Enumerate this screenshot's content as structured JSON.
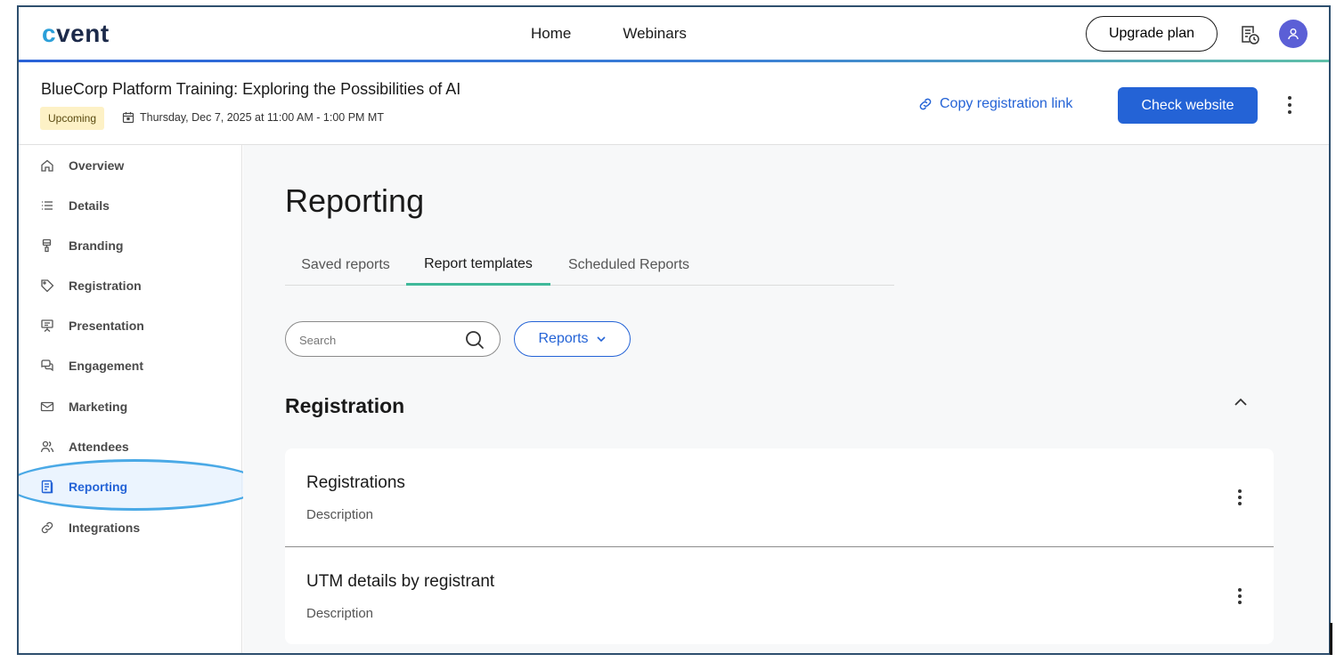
{
  "app": {
    "logo_text": "cvent",
    "logo_c": "c",
    "logo_rest": "vent"
  },
  "topnav": {
    "items": [
      "Home",
      "Webinars"
    ],
    "upgrade_label": "Upgrade plan"
  },
  "event": {
    "title": "BlueCorp Platform Training: Exploring the Possibilities of AI",
    "status_badge": "Upcoming",
    "date": "Thursday, Dec 7, 2025 at 11:00 AM - 1:00 PM MT",
    "copy_link_label": "Copy registration link",
    "check_website_label": "Check website"
  },
  "sidebar": {
    "items": [
      {
        "label": "Overview",
        "icon": "home-icon"
      },
      {
        "label": "Details",
        "icon": "list-icon"
      },
      {
        "label": "Branding",
        "icon": "paint-brush-icon"
      },
      {
        "label": "Registration",
        "icon": "tag-icon"
      },
      {
        "label": "Presentation",
        "icon": "presentation-icon"
      },
      {
        "label": "Engagement",
        "icon": "chat-bubbles-icon"
      },
      {
        "label": "Marketing",
        "icon": "mail-icon"
      },
      {
        "label": "Attendees",
        "icon": "people-icon"
      },
      {
        "label": "Reporting",
        "icon": "report-icon",
        "active": true
      },
      {
        "label": "Integrations",
        "icon": "link-icon"
      }
    ]
  },
  "main": {
    "page_title": "Reporting",
    "tabs": [
      {
        "label": "Saved reports"
      },
      {
        "label": "Report templates",
        "active": true
      },
      {
        "label": "Scheduled Reports"
      }
    ],
    "search": {
      "placeholder": "Search",
      "value": ""
    },
    "filter_label": "Reports",
    "section_title": "Registration",
    "cards": [
      {
        "title": "Registrations",
        "description": "Description"
      },
      {
        "title": "UTM details by registrant",
        "description": "Description"
      }
    ]
  },
  "colors": {
    "accent": "#2463d6",
    "tab_indicator": "#3fb99a",
    "badge_bg": "#fdf1c6",
    "avatar_bg": "#5b5fd6",
    "highlight_ring": "#4aa9e6"
  }
}
